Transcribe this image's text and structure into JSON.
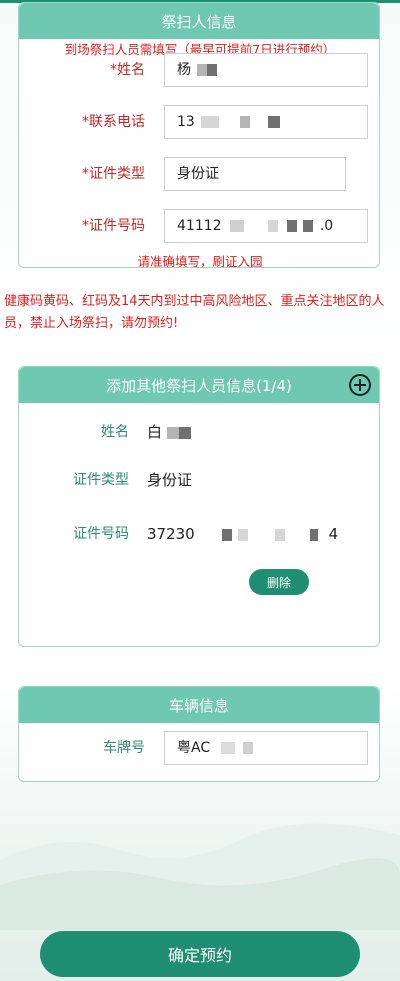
{
  "primary_card": {
    "title": "祭扫人信息",
    "notice": "到场祭扫人员需填写（最早可提前7日进行预约）",
    "name_label": "姓名",
    "name_value": "杨",
    "phone_label": "联系电话",
    "phone_value": "13",
    "id_type_label": "证件类型",
    "id_type_value": "身份证",
    "id_number_label": "证件号码",
    "id_number_value": "41112",
    "id_number_tail": ".0",
    "hint": "请准确填写，刷证入园",
    "required_mark": "*"
  },
  "warning": "健康码黄码、红码及14天内到过中高风险地区、重点关注地区的人员，禁止入场祭扫，请勿预约!",
  "extra_card": {
    "title": "添加其他祭扫人员信息(1/4)",
    "name_label": "姓名",
    "name_value": "白",
    "id_type_label": "证件类型",
    "id_type_value": "身份证",
    "id_number_label": "证件号码",
    "id_number_value": "37230",
    "id_number_tail": "4",
    "delete_label": "删除"
  },
  "vehicle_card": {
    "title": "车辆信息",
    "plate_label": "车牌号",
    "plate_value": "粤AC"
  },
  "submit_label": "确定预约",
  "colors": {
    "primary": "#1e8f73",
    "header": "#6fc9b2",
    "required": "#e02020"
  }
}
